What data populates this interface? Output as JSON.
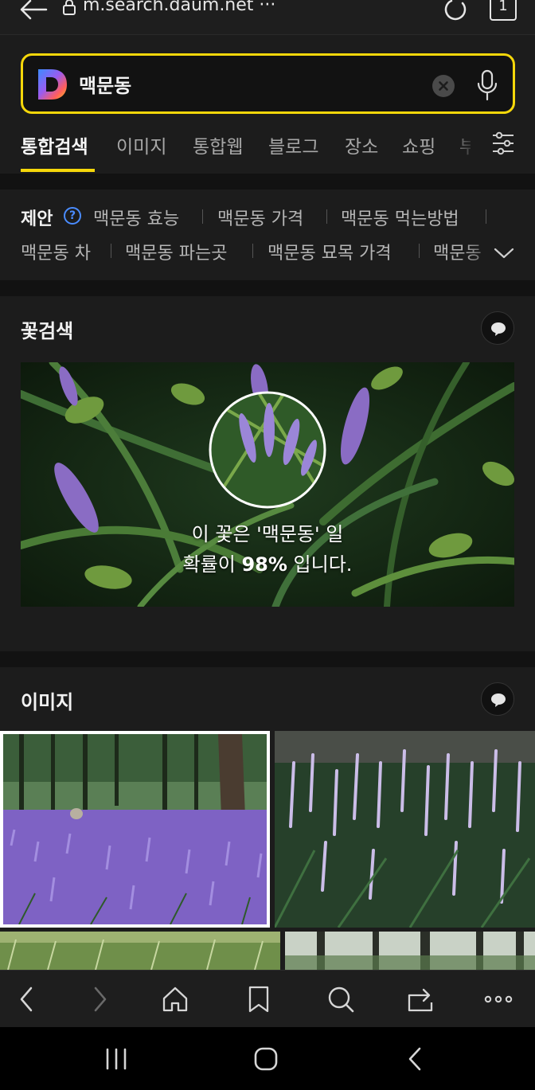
{
  "browser": {
    "url": "m.search.daum.net",
    "url_more": "···",
    "tab_count": "1"
  },
  "search": {
    "query": "맥문동"
  },
  "tabs": [
    "통합검색",
    "이미지",
    "통합웹",
    "블로그",
    "장소",
    "쇼핑",
    "부"
  ],
  "suggestions": {
    "title": "제안",
    "help": "?",
    "row1": [
      "맥문동 효능",
      "맥문동 가격",
      "맥문동 먹는방법"
    ],
    "row2": [
      "맥문동 차",
      "맥문동 파는곳",
      "맥문동 묘목 가격",
      "맥문동"
    ]
  },
  "flower_search": {
    "title": "꽃검색",
    "caption_line1": "이 꽃은 '맥문동' 일",
    "caption_pre": "확률이 ",
    "probability": "98%",
    "caption_post": " 입니다."
  },
  "images_section": {
    "title": "이미지"
  },
  "colors": {
    "accent": "#f5d70a",
    "background": "#1c1c1c",
    "help_blue": "#4a8cff"
  },
  "toolbar_icons": [
    "back-icon",
    "forward-icon",
    "home-icon",
    "bookmark-icon",
    "search-icon",
    "tabs-switch-icon",
    "more-icon"
  ],
  "navbar_icons": [
    "recent-apps-icon",
    "home-icon",
    "back-icon"
  ]
}
